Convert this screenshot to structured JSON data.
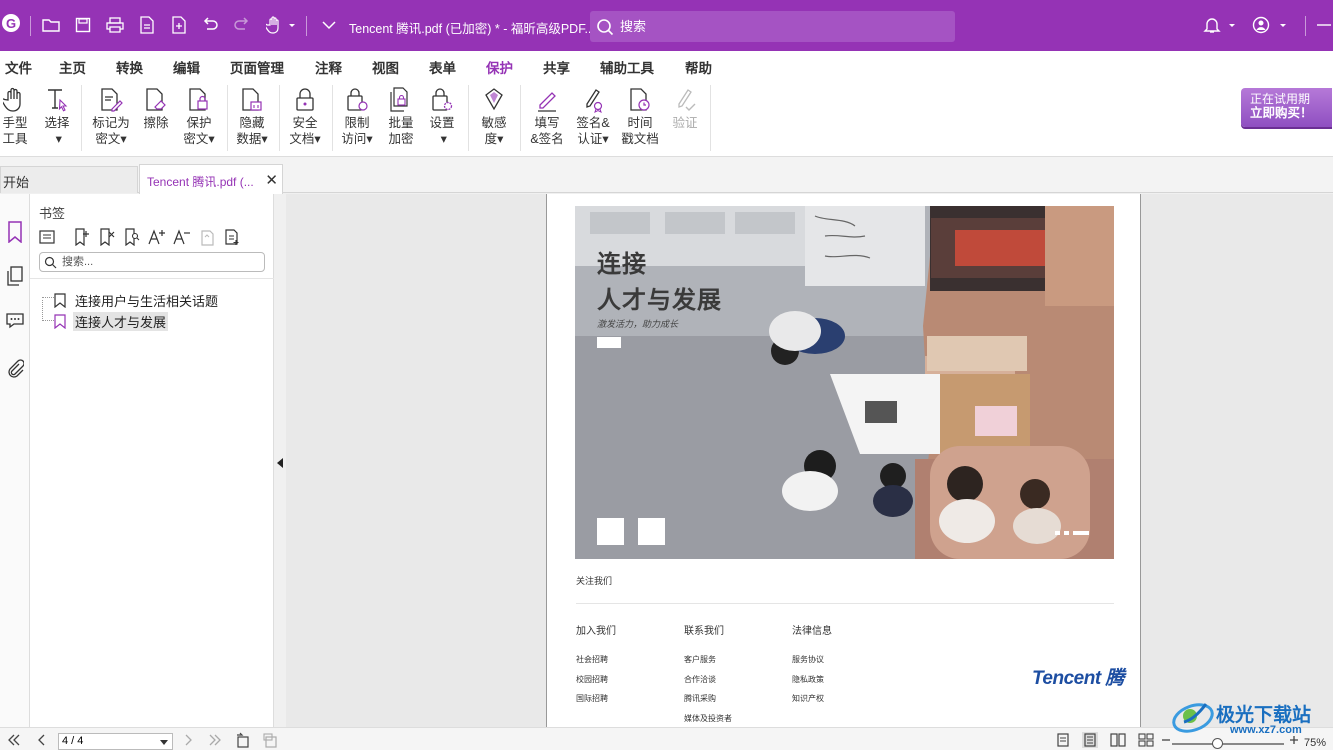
{
  "titlebar": {
    "logo_letter": "G",
    "doc_title": "Tencent 腾讯.pdf (已加密) * - 福昕高级PDF...",
    "search_placeholder": "搜索"
  },
  "menu": [
    {
      "label": "文件",
      "active": false
    },
    {
      "label": "主页",
      "active": false
    },
    {
      "label": "转换",
      "active": false
    },
    {
      "label": "编辑",
      "active": false
    },
    {
      "label": "页面管理",
      "active": false
    },
    {
      "label": "注释",
      "active": false
    },
    {
      "label": "视图",
      "active": false
    },
    {
      "label": "表单",
      "active": false
    },
    {
      "label": "保护",
      "active": true
    },
    {
      "label": "共享",
      "active": false
    },
    {
      "label": "辅助工具",
      "active": false
    },
    {
      "label": "帮助",
      "active": false
    }
  ],
  "ribbon": {
    "hand": "手型\n工具",
    "select": "选择\n ▾",
    "mark_redact": "标记为\n密文▾",
    "erase": "擦除",
    "protect_redact": "保护\n密文▾",
    "hide_data": "隐藏\n数据▾",
    "secure_doc": "安全\n文档▾",
    "restrict": "限制\n访问▾",
    "batch_encrypt": "批量\n加密",
    "settings": "设置\n ▾",
    "sensitivity": "敏感\n度▾",
    "fill_sign": "填写\n&签名",
    "sign_cert": "签名&\n认证▾",
    "timestamp": "时间\n戳文档",
    "verify": "验证"
  },
  "trial": {
    "line1": "正在试用期",
    "line2": "立即购买！"
  },
  "tabs": {
    "start": "开始",
    "doc": "Tencent 腾讯.pdf (...",
    "close": "✕"
  },
  "bookmarks": {
    "title": "书签",
    "search_placeholder": "搜索...",
    "items": [
      "连接用户与生活相关话题",
      "连接人才与发展"
    ]
  },
  "page": {
    "headline1": "连接",
    "headline2": "人才与发展",
    "subline": "激发活力，助力成长",
    "follow": "关注我们",
    "columns": [
      {
        "heading": "加入我们",
        "items": [
          "社会招聘",
          "校园招聘",
          "国际招聘"
        ]
      },
      {
        "heading": "联系我们",
        "items": [
          "客户服务",
          "合作洽谈",
          "腾讯采购",
          "媒体及投资者"
        ]
      },
      {
        "heading": "法律信息",
        "items": [
          "服务协议",
          "隐私政策",
          "知识产权"
        ]
      }
    ],
    "brand": "Tencent 腾"
  },
  "statusbar": {
    "page_value": "4 / 4",
    "zoom": "75%",
    "zoom_level": 0.4
  },
  "watermark": {
    "name": "极光下载站",
    "url": "www.xz7.com"
  },
  "colors": {
    "accent": "#9533b5",
    "brand_blue": "#1d4ea2"
  }
}
